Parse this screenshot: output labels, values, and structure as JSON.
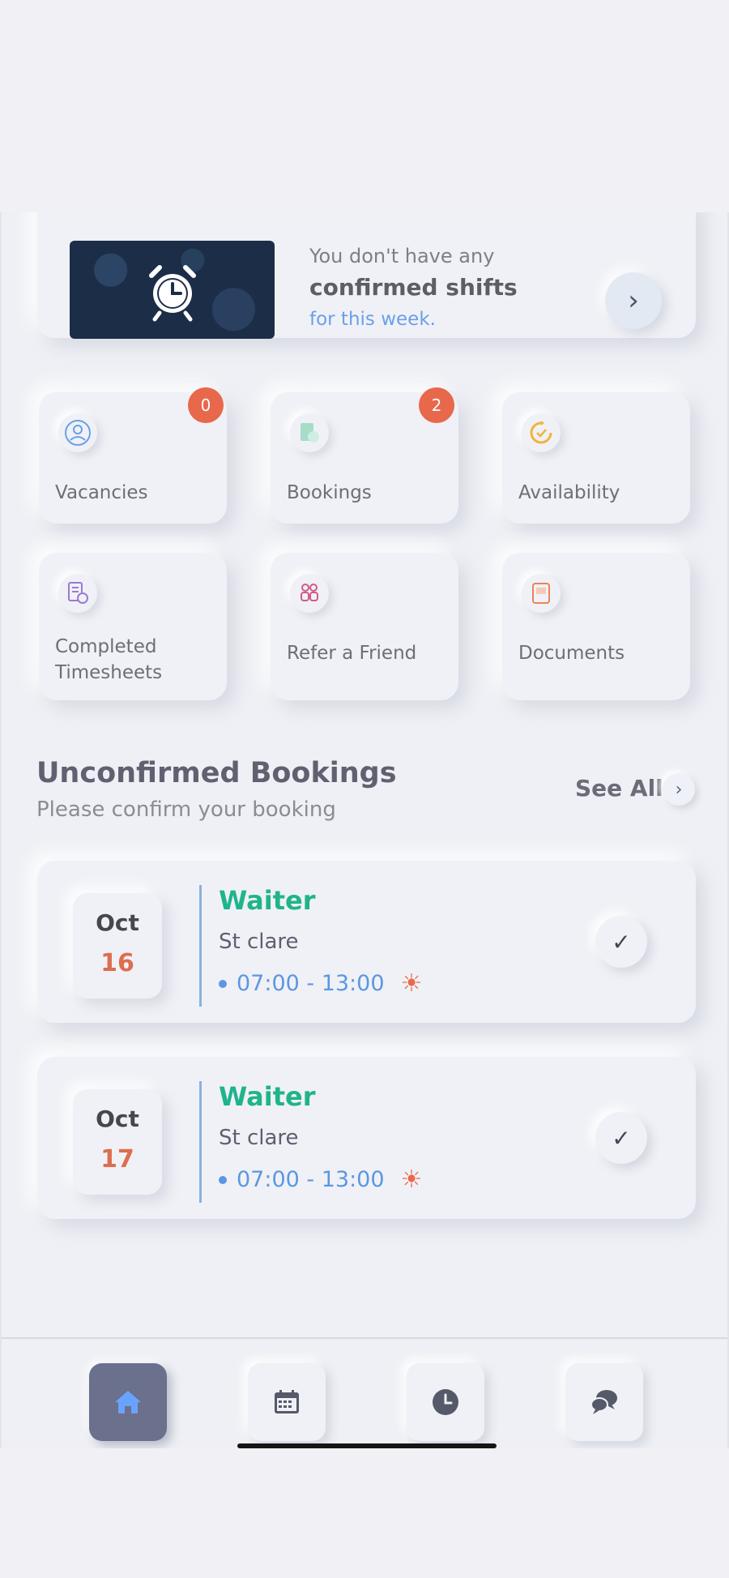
{
  "shift_banner": {
    "line1": "You don't have any",
    "line2": "confirmed shifts",
    "line3": "for this week.",
    "image_icon": "alarm-clock-icon",
    "arrow_icon": "chevron-right-icon"
  },
  "tiles": [
    {
      "label": "Vacancies",
      "icon": "user-circle-icon",
      "badge": "0"
    },
    {
      "label": "Bookings",
      "icon": "booking-icon",
      "badge": "2"
    },
    {
      "label": "Availability",
      "icon": "availability-icon"
    },
    {
      "label": "Completed Timesheets",
      "icon": "timesheet-icon"
    },
    {
      "label": "Refer a Friend",
      "icon": "people-icon"
    },
    {
      "label": "Documents",
      "icon": "document-icon"
    }
  ],
  "section": {
    "title": "Unconfirmed Bookings",
    "subtitle": "Please confirm your booking",
    "see_all": "See All"
  },
  "bookings": [
    {
      "month": "Oct",
      "day": "16",
      "role": "Waiter",
      "place": "St clare",
      "time": "07:00 - 13:00"
    },
    {
      "month": "Oct",
      "day": "17",
      "role": "Waiter",
      "place": "St clare",
      "time": "07:00 - 13:00"
    }
  ],
  "nav": [
    {
      "icon": "home-icon",
      "active": true
    },
    {
      "icon": "calendar-icon",
      "active": false
    },
    {
      "icon": "clock-icon",
      "active": false
    },
    {
      "icon": "chat-icon",
      "active": false
    }
  ],
  "colors": {
    "accent_green": "#1fb48c",
    "accent_blue": "#5b97e2",
    "badge_orange": "#e8684b",
    "nav_active": "#6b708c"
  }
}
